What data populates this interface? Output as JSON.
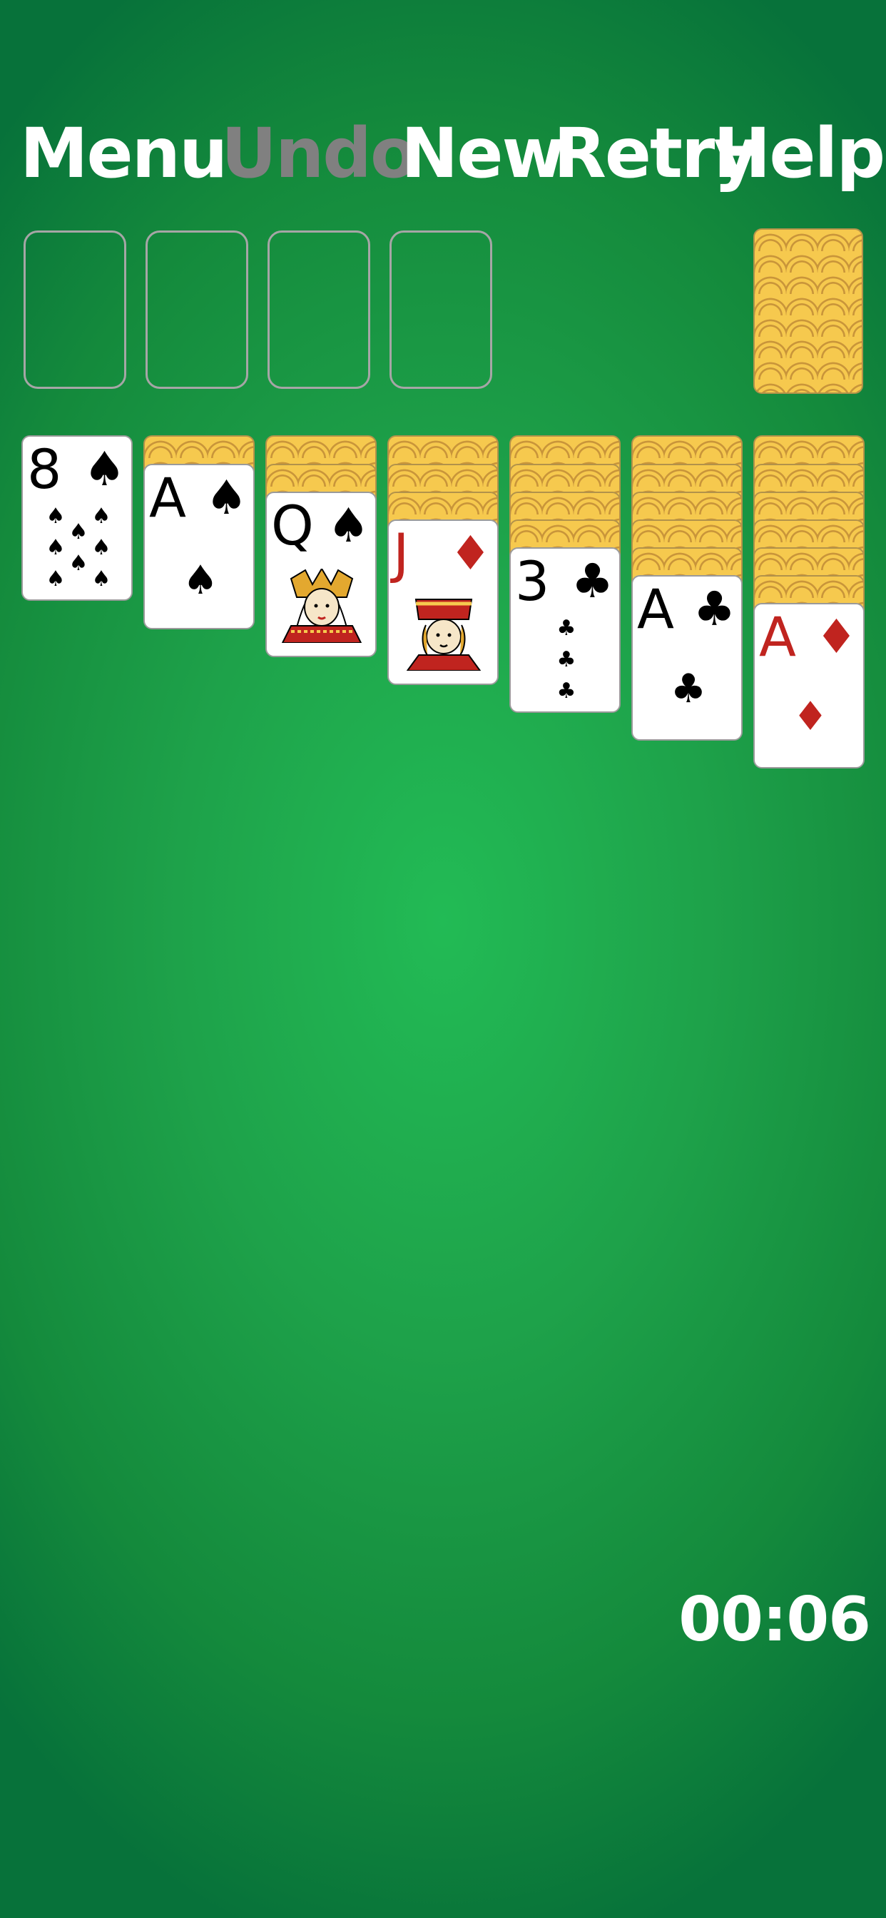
{
  "menu": {
    "menu_label": "Menu",
    "undo_label": "Undo",
    "new_label": "New",
    "retry_label": "Retry",
    "help_label": "Help"
  },
  "foundations": [
    "empty",
    "empty",
    "empty",
    "empty"
  ],
  "stock": {
    "state": "face-down"
  },
  "tableau": [
    {
      "face_down": 0,
      "top": {
        "rank": "8",
        "suit": "♠",
        "color": "black"
      }
    },
    {
      "face_down": 1,
      "top": {
        "rank": "A",
        "suit": "♠",
        "color": "black"
      }
    },
    {
      "face_down": 2,
      "top": {
        "rank": "Q",
        "suit": "♠",
        "color": "black"
      }
    },
    {
      "face_down": 3,
      "top": {
        "rank": "J",
        "suit": "♦",
        "color": "red"
      }
    },
    {
      "face_down": 4,
      "top": {
        "rank": "3",
        "suit": "♣",
        "color": "black"
      }
    },
    {
      "face_down": 5,
      "top": {
        "rank": "A",
        "suit": "♣",
        "color": "black"
      }
    },
    {
      "face_down": 6,
      "top": {
        "rank": "A",
        "suit": "♦",
        "color": "red"
      }
    }
  ],
  "timer": "00:06",
  "colors": {
    "felt": "#1ea24a",
    "card_back": "#f6c94e",
    "red_suit": "#c0241f",
    "disabled_text": "#808080"
  }
}
